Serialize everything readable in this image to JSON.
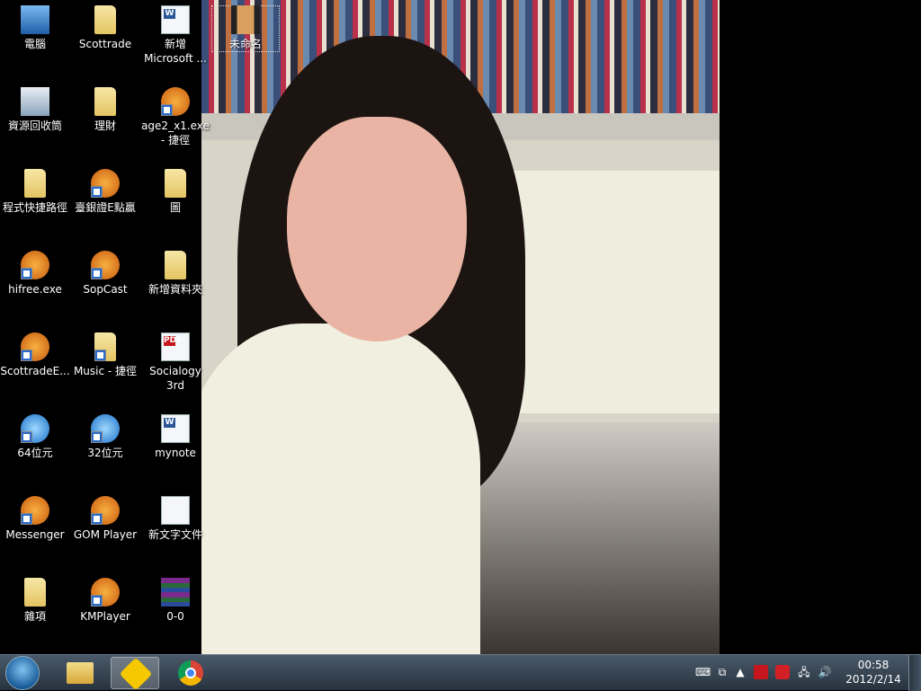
{
  "desktop_icons": [
    {
      "label": "電腦",
      "type": "computer"
    },
    {
      "label": "資源回收筒",
      "type": "recycle"
    },
    {
      "label": "程式快捷路徑",
      "type": "folder"
    },
    {
      "label": "hifree.exe",
      "type": "app-shortcut"
    },
    {
      "label": "ScottradeE...",
      "type": "app-shortcut"
    },
    {
      "label": "64位元",
      "type": "ie-shortcut"
    },
    {
      "label": "Messenger",
      "type": "app-shortcut"
    },
    {
      "label": "雜項",
      "type": "folder"
    },
    {
      "label": "Scottrade",
      "type": "folder"
    },
    {
      "label": "理財",
      "type": "folder"
    },
    {
      "label": "臺銀證E點贏",
      "type": "app-shortcut"
    },
    {
      "label": "SopCast",
      "type": "app-shortcut"
    },
    {
      "label": "Music - 捷徑",
      "type": "folder-shortcut"
    },
    {
      "label": "32位元",
      "type": "ie-shortcut"
    },
    {
      "label": "GOM Player",
      "type": "app-shortcut"
    },
    {
      "label": "KMPlayer",
      "type": "app-shortcut"
    },
    {
      "label": "新增 Microsoft ...",
      "type": "word-doc"
    },
    {
      "label": "age2_x1.exe - 捷徑",
      "type": "app-shortcut"
    },
    {
      "label": "圖",
      "type": "folder"
    },
    {
      "label": "新增資料夾",
      "type": "folder"
    },
    {
      "label": "Socialogy 3rd",
      "type": "pdf"
    },
    {
      "label": "mynote",
      "type": "word-doc"
    },
    {
      "label": "新文字文件",
      "type": "text-doc"
    },
    {
      "label": "0-0",
      "type": "rar"
    },
    {
      "label": "未命名",
      "type": "image",
      "selected": true
    }
  ],
  "taskbar": {
    "pinned": [
      {
        "name": "windows-explorer"
      },
      {
        "name": "app-active"
      },
      {
        "name": "google-chrome"
      }
    ],
    "clock": {
      "time": "00:58",
      "date": "2012/2/14"
    }
  }
}
